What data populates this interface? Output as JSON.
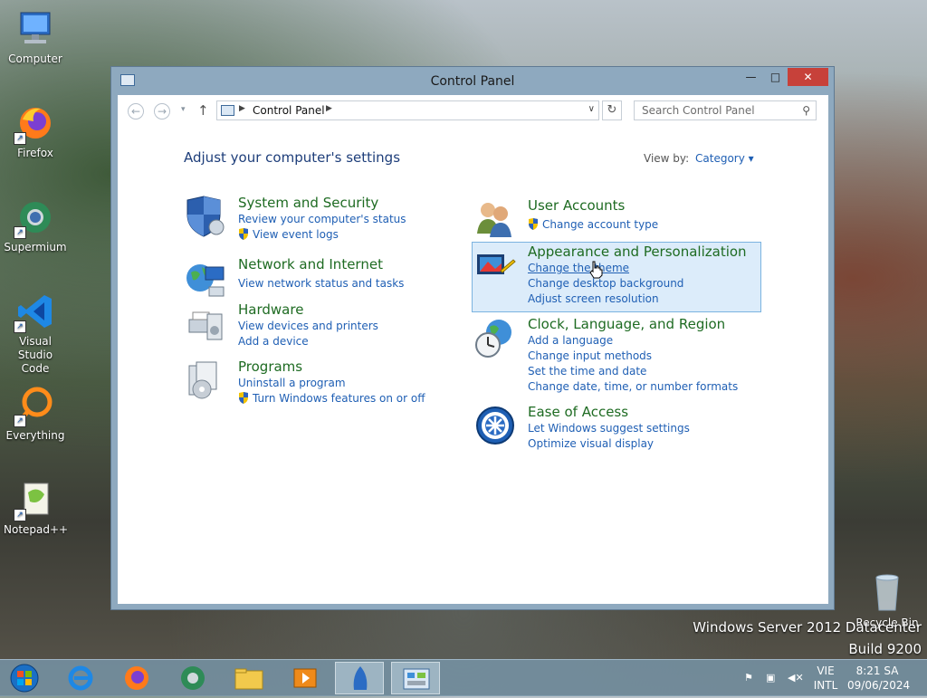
{
  "desktop": {
    "icons": [
      {
        "label": "Computer"
      },
      {
        "label": "Firefox"
      },
      {
        "label": "Supermium"
      },
      {
        "label": "Visual Studio Code"
      },
      {
        "label": "Everything"
      },
      {
        "label": "Notepad++"
      }
    ],
    "recycle_bin": "Recycle Bin",
    "watermark_line1": "Windows Server 2012 Datacenter",
    "watermark_line2": "Build 9200"
  },
  "window": {
    "title": "Control Panel",
    "minimize_glyph": "—",
    "maximize_glyph": "□",
    "close_glyph": "✕"
  },
  "navbar": {
    "address_text": "Control Panel",
    "search_placeholder": "Search Control Panel"
  },
  "content": {
    "heading": "Adjust your computer's settings",
    "view_by_label": "View by:",
    "view_by_value": "Category ▾",
    "left": [
      {
        "title": "System and Security",
        "links": [
          "Review your computer's status",
          "View event logs"
        ]
      },
      {
        "title": "Network and Internet",
        "links": [
          "View network status and tasks"
        ]
      },
      {
        "title": "Hardware",
        "links": [
          "View devices and printers",
          "Add a device"
        ]
      },
      {
        "title": "Programs",
        "links": [
          "Uninstall a program",
          "Turn Windows features on or off"
        ]
      }
    ],
    "right": [
      {
        "title": "User Accounts",
        "links": [
          "Change account type"
        ]
      },
      {
        "title": "Appearance and Personalization",
        "links": [
          "Change the theme",
          "Change desktop background",
          "Adjust screen resolution"
        ]
      },
      {
        "title": "Clock, Language, and Region",
        "links": [
          "Add a language",
          "Change input methods",
          "Set the time and date",
          "Change date, time, or number formats"
        ]
      },
      {
        "title": "Ease of Access",
        "links": [
          "Let Windows suggest settings",
          "Optimize visual display"
        ]
      }
    ]
  },
  "taskbar": {
    "lang_line1": "VIE",
    "lang_line2": "INTL",
    "time": "8:21 SA",
    "date": "09/06/2024"
  }
}
